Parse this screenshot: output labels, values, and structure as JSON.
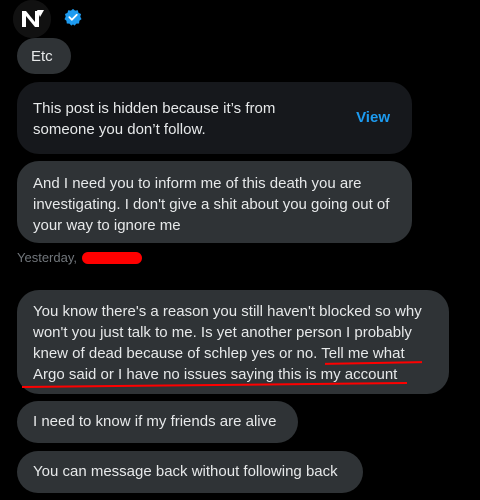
{
  "header": {
    "avatar_icon": "brand-logo-icon",
    "verified_icon": "verified-badge-icon",
    "verified_color": "#1d9bf0"
  },
  "messages": {
    "etc": "Etc",
    "hidden_post_text": "This post is hidden because it’s from someone you don’t follow.",
    "view_label": "View",
    "inform": "And I need you to inform me of this death you are investigating. I don't give a shit about you going out of your way to ignore me",
    "timestamp": "Yesterday,",
    "know_reason": "You know there's a reason you still haven't blocked so why won't you just talk to me. Is yet another person I probably knew of dead because of schlep yes or no. Tell me what Argo said or I have no issues saying this is my account",
    "friends": "I need to know if my friends are alive",
    "message_back": "You can message back without following back"
  },
  "colors": {
    "bubble_bg": "#2f3336",
    "card_bg": "#16181c",
    "link": "#1d9bf0",
    "redaction": "#ff0000",
    "muted_text": "#71767b"
  }
}
